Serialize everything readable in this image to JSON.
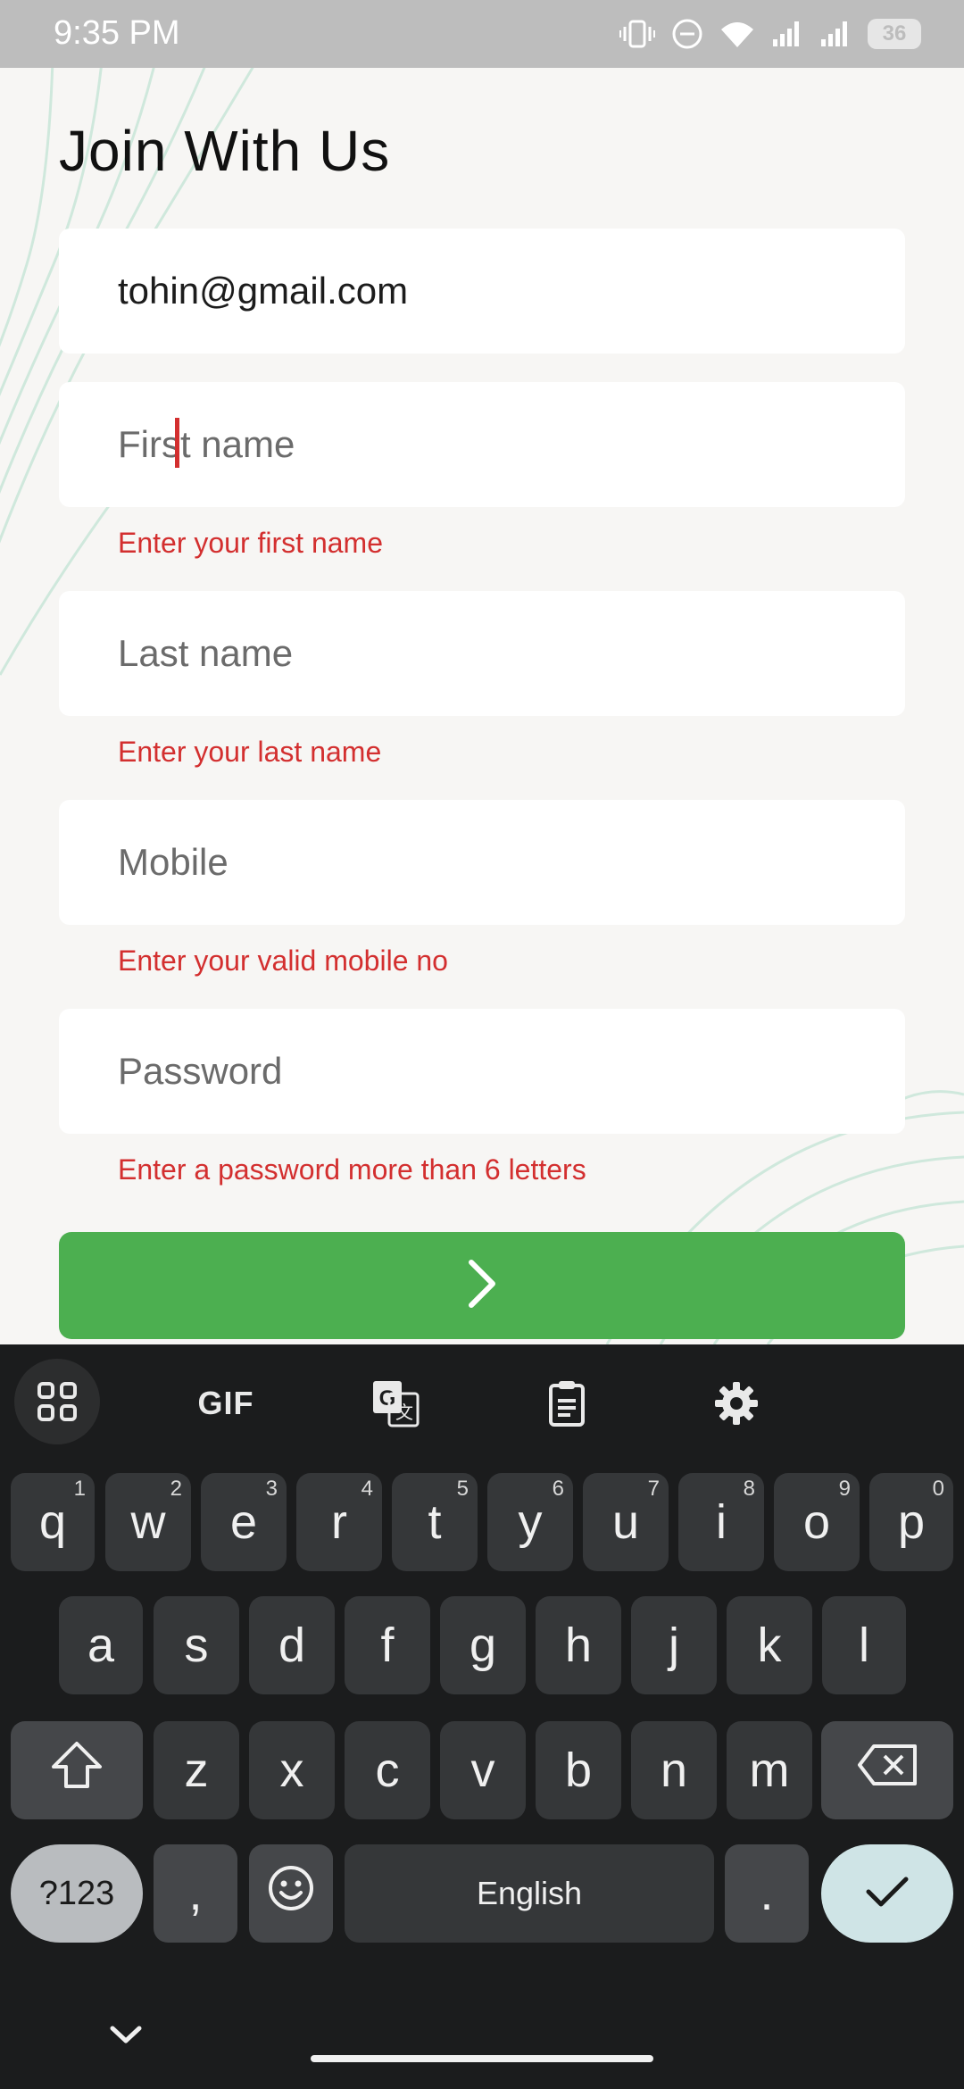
{
  "status_bar": {
    "time": "9:35 PM",
    "battery": "36"
  },
  "form": {
    "title": "Join With Us",
    "email": {
      "value": "tohin@gmail.com"
    },
    "first_name": {
      "placeholder": "First name",
      "error": "Enter your first name"
    },
    "last_name": {
      "placeholder": "Last name",
      "error": "Enter your last name"
    },
    "mobile": {
      "placeholder": "Mobile",
      "error": "Enter your valid mobile no"
    },
    "password": {
      "placeholder": "Password",
      "error": "Enter a password more than 6 letters"
    },
    "submit_icon": "chevron-right-icon",
    "colors": {
      "accent": "#4caf50",
      "error": "#d32f2f"
    }
  },
  "keyboard": {
    "toolbar": {
      "gif_label": "GIF",
      "icons": [
        "apps-grid-icon",
        "translate-icon",
        "clipboard-icon",
        "settings-gear-icon"
      ]
    },
    "row1": [
      {
        "key": "q",
        "sup": "1"
      },
      {
        "key": "w",
        "sup": "2"
      },
      {
        "key": "e",
        "sup": "3"
      },
      {
        "key": "r",
        "sup": "4"
      },
      {
        "key": "t",
        "sup": "5"
      },
      {
        "key": "y",
        "sup": "6"
      },
      {
        "key": "u",
        "sup": "7"
      },
      {
        "key": "i",
        "sup": "8"
      },
      {
        "key": "o",
        "sup": "9"
      },
      {
        "key": "p",
        "sup": "0"
      }
    ],
    "row2": [
      "a",
      "s",
      "d",
      "f",
      "g",
      "h",
      "j",
      "k",
      "l"
    ],
    "row3": [
      "z",
      "x",
      "c",
      "v",
      "b",
      "n",
      "m"
    ],
    "bottom": {
      "symbols": "?123",
      "comma": ",",
      "space": "English",
      "period": "."
    }
  }
}
